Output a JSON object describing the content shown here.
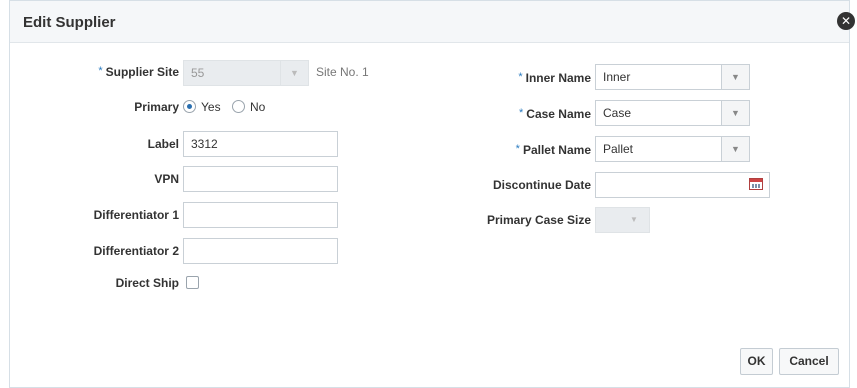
{
  "dialog": {
    "title": "Edit Supplier",
    "close_glyph": "✕"
  },
  "left": {
    "supplier_site": {
      "label": "Supplier Site",
      "required": "*",
      "value": "55",
      "site_no": "Site No. 1"
    },
    "primary": {
      "label": "Primary",
      "yes": "Yes",
      "no": "No",
      "selected": "Yes"
    },
    "label": {
      "label": "Label",
      "value": "3312"
    },
    "vpn": {
      "label": "VPN",
      "value": ""
    },
    "diff1": {
      "label": "Differentiator 1",
      "value": ""
    },
    "diff2": {
      "label": "Differentiator 2",
      "value": ""
    },
    "direct_ship": {
      "label": "Direct Ship",
      "checked": false
    }
  },
  "right": {
    "inner_name": {
      "label": "Inner Name",
      "required": "*",
      "value": "Inner"
    },
    "case_name": {
      "label": "Case Name",
      "required": "*",
      "value": "Case"
    },
    "pallet_name": {
      "label": "Pallet Name",
      "required": "*",
      "value": "Pallet"
    },
    "discontinue_date": {
      "label": "Discontinue Date",
      "value": "",
      "icon": "calendar-icon"
    },
    "primary_case_size": {
      "label": "Primary Case Size",
      "value": ""
    }
  },
  "buttons": {
    "ok": "OK",
    "cancel": "Cancel"
  },
  "dropdown_glyph": "▼",
  "colors": {
    "required": "#2a7bc0",
    "radio_selected": "#2a6fb0",
    "calendar": "#c44444"
  }
}
